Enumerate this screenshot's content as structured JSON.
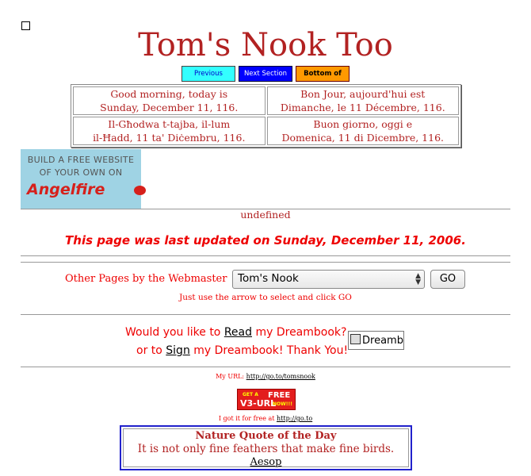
{
  "page": {
    "title": "Tom's Nook Too"
  },
  "nav": {
    "previous": "Previous Section",
    "next": "Next Section",
    "bottom": "Bottom of Page"
  },
  "greetings": [
    {
      "line1": "Good morning, today is",
      "line2": "Sunday, December 11, 116."
    },
    {
      "line1": "Bon Jour, aujourd'hui est",
      "line2": "Dimanche, le 11 Décembre, 116."
    },
    {
      "line1": "Il-Għodwa t-tajba, il-lum",
      "line2": "il-Ħadd, 11 ta' Diċembru, 116."
    },
    {
      "line1": "Buon giorno, oggi e",
      "line2": "Domenica, 11 di Dicembre, 116."
    }
  ],
  "banner": {
    "line1": "BUILD A FREE WEBSITE",
    "line2": "OF YOUR OWN ON",
    "brand": "Angelfire"
  },
  "status": {
    "undefined_text": "undefined",
    "last_updated": "This page was last updated on Sunday, December 11, 2006."
  },
  "other_pages": {
    "label": "Other Pages by the Webmaster",
    "selected": "Tom's Nook",
    "go": "GO",
    "hint": "Just use the arrow to select and click GO"
  },
  "dreambook": {
    "q_prefix": "Would you like to ",
    "read": "Read",
    "q_suffix": " my Dreambook?",
    "s_prefix": "or to ",
    "sign": "Sign",
    "s_suffix": " my Dreambook! Thank You!",
    "image_alt": "Dreamb"
  },
  "urls": {
    "my_url_label": "My URL: ",
    "my_url": "http://go.to/tomsnook",
    "got_free_label": "I got it for free at ",
    "got_free_url": "http://go.to"
  },
  "v3": {
    "get": "GET A",
    "name": "V3-URL",
    "free": "FREE",
    "now": "NOW!!!"
  },
  "quote": {
    "heading": "Nature Quote of the Day",
    "text": "It is not only fine feathers that make fine birds.",
    "author": "Aesop"
  },
  "colors": {
    "title": "#b22222",
    "accent_red": "#e00000",
    "quote_border": "#2222cc"
  }
}
